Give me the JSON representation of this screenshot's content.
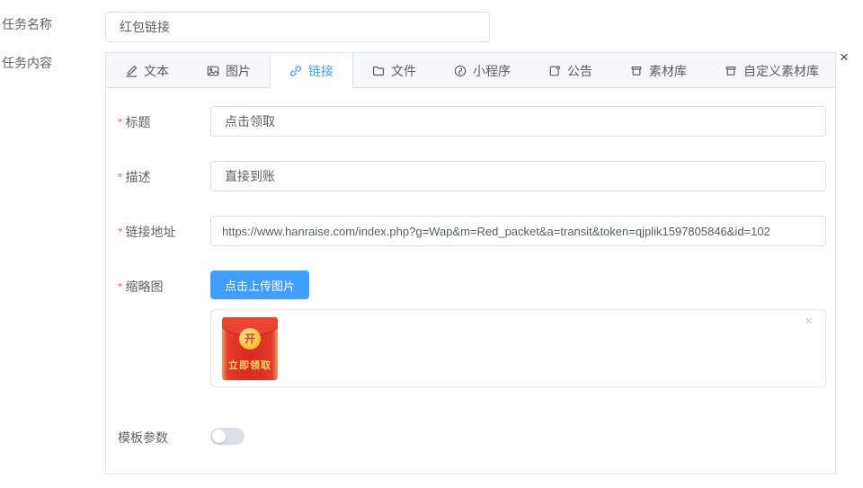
{
  "page": {
    "task_name_label": "任务名称",
    "task_content_label": "任务内容"
  },
  "task_name_input": {
    "value": "红包链接"
  },
  "panel": {
    "close_label": "×"
  },
  "tabs": [
    {
      "label": "文本",
      "icon": "edit-icon",
      "active": false
    },
    {
      "label": "图片",
      "icon": "image-icon",
      "active": false
    },
    {
      "label": "链接",
      "icon": "link-icon",
      "active": true
    },
    {
      "label": "文件",
      "icon": "folder-icon",
      "active": false
    },
    {
      "label": "小程序",
      "icon": "miniprogram-icon",
      "active": false
    },
    {
      "label": "公告",
      "icon": "announcement-icon",
      "active": false
    },
    {
      "label": "素材库",
      "icon": "archive-icon",
      "active": false
    },
    {
      "label": "自定义素材库",
      "icon": "archive-icon",
      "active": false
    }
  ],
  "ui": {
    "required_mark": "*"
  },
  "form": {
    "title": {
      "label": "标题",
      "required": true,
      "value": "点击领取"
    },
    "description": {
      "label": "描述",
      "required": true,
      "value": "直接到账"
    },
    "link_url": {
      "label": "链接地址",
      "required": true,
      "value": "https://www.hanraise.com/index.php?g=Wap&m=Red_packet&a=transit&token=qjplik1597805846&id=102"
    },
    "thumbnail": {
      "label": "缩略图",
      "required": true,
      "upload_button_label": "点击上传图片",
      "preview": {
        "open_char": "开",
        "claim_text": "立即领取",
        "remove_label": "×"
      }
    },
    "template_params": {
      "label": "模板参数",
      "toggle_on": false
    }
  },
  "colors": {
    "accent_blue": "#409EFF",
    "required_red": "#F56C6C",
    "tab_bar_bg": "#F5F7FA",
    "packet_red": "#DA2A20",
    "packet_gold": "#FCBB33"
  }
}
